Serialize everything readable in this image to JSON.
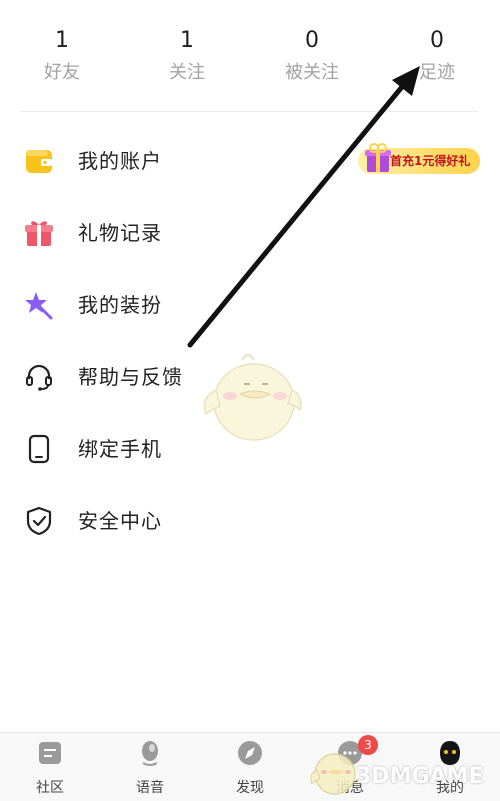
{
  "stats": [
    {
      "count": "1",
      "label": "好友"
    },
    {
      "count": "1",
      "label": "关注"
    },
    {
      "count": "0",
      "label": "被关注"
    },
    {
      "count": "0",
      "label": "足迹"
    }
  ],
  "menu": [
    {
      "label": "我的账户",
      "icon": "wallet-icon"
    },
    {
      "label": "礼物记录",
      "icon": "gift-icon"
    },
    {
      "label": "我的装扮",
      "icon": "star-wand-icon"
    },
    {
      "label": "帮助与反馈",
      "icon": "headset-icon"
    },
    {
      "label": "绑定手机",
      "icon": "phone-icon"
    },
    {
      "label": "安全中心",
      "icon": "shield-icon"
    }
  ],
  "promo": {
    "text": "首充1元得好礼"
  },
  "tabs": [
    {
      "label": "社区",
      "icon": "community-icon"
    },
    {
      "label": "语音",
      "icon": "voice-icon"
    },
    {
      "label": "发现",
      "icon": "compass-icon"
    },
    {
      "label": "消息",
      "icon": "message-icon",
      "badge": "3"
    },
    {
      "label": "我的",
      "icon": "profile-icon"
    }
  ],
  "watermark": "3DMGAME",
  "colors": {
    "accent": "#f7c21a",
    "badge": "#ef4a4a",
    "gift": "#f0566b",
    "purple": "#8a5cf5"
  }
}
